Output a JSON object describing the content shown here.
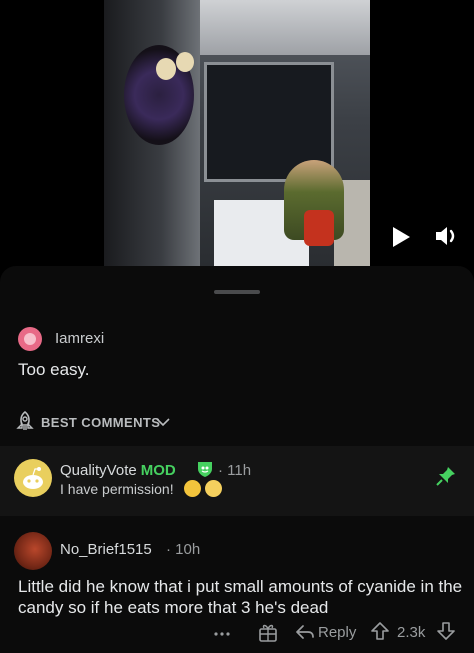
{
  "post": {
    "username": "Iamrexi",
    "text": "Too easy."
  },
  "sort": {
    "label": "BEST COMMENTS"
  },
  "comments": [
    {
      "username": "QualityVote",
      "mod_label": "MOD",
      "separator": "·",
      "time": "11h",
      "flair_text": "I have permission!",
      "pinned": true
    },
    {
      "username": "No_Brief1515",
      "separator": "·",
      "time": "10h",
      "body": "Little did he know that i put small amounts of cyanide in the candy so if he eats more that 3 he's dead",
      "reply_label": "Reply",
      "score": "2.3k"
    }
  ],
  "colors": {
    "mod_green": "#46d160",
    "background": "#000000",
    "sheet": "#0b0b0b",
    "pinned_comment_bg": "#141414"
  },
  "icons": [
    "play-icon",
    "volume-icon",
    "rocket-icon",
    "chevron-down-icon",
    "shield-icon",
    "pin-icon",
    "more-icon",
    "award-icon",
    "reply-icon",
    "upvote-icon",
    "downvote-icon"
  ]
}
